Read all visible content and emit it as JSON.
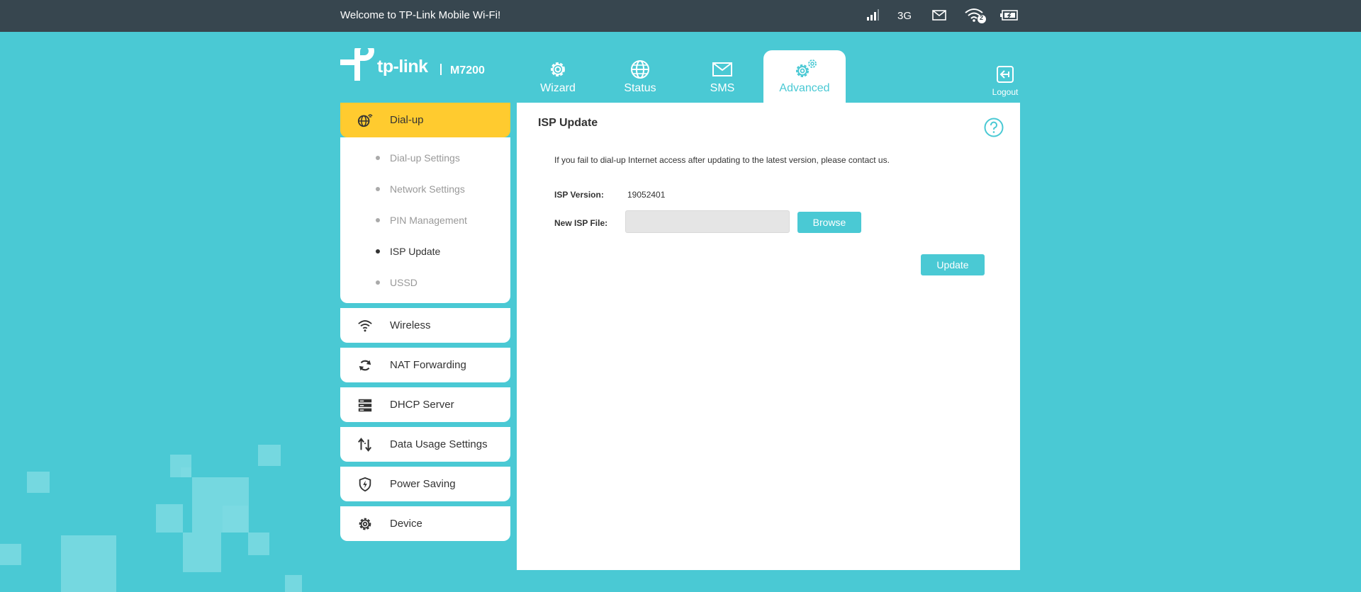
{
  "topbar": {
    "welcome": "Welcome to TP-Link Mobile Wi-Fi!",
    "network_type": "3G",
    "wifi_clients": "2",
    "icons": [
      "signal-icon",
      "mail-icon",
      "wifi-icon",
      "battery-icon"
    ]
  },
  "logo": {
    "brand": "tp-link",
    "model": "M7200"
  },
  "tabs": [
    {
      "label": "Wizard",
      "icon": "gear-icon"
    },
    {
      "label": "Status",
      "icon": "globe-icon"
    },
    {
      "label": "SMS",
      "icon": "envelope-icon"
    },
    {
      "label": "Advanced",
      "icon": "gears-icon",
      "active": true
    }
  ],
  "logout": {
    "label": "Logout"
  },
  "sidebar": {
    "items": [
      {
        "label": "Dial-up",
        "icon": "globe-signal-icon",
        "active": true,
        "sub": [
          {
            "label": "Dial-up Settings"
          },
          {
            "label": "Network Settings"
          },
          {
            "label": "PIN Management"
          },
          {
            "label": "ISP Update",
            "active": true
          },
          {
            "label": "USSD"
          }
        ]
      },
      {
        "label": "Wireless",
        "icon": "wifi-icon"
      },
      {
        "label": "NAT Forwarding",
        "icon": "refresh-icon"
      },
      {
        "label": "DHCP Server",
        "icon": "server-icon"
      },
      {
        "label": "Data Usage Settings",
        "icon": "up-down-arrows-icon"
      },
      {
        "label": "Power Saving",
        "icon": "shield-bolt-icon"
      },
      {
        "label": "Device",
        "icon": "gear-icon"
      }
    ]
  },
  "panel": {
    "title": "ISP Update",
    "note": "If you fail to dial-up Internet access after updating to the latest version, please contact us.",
    "isp_version_label": "ISP Version:",
    "isp_version_value": "19052401",
    "new_file_label": "New ISP File:",
    "new_file_value": "",
    "browse_label": "Browse",
    "update_label": "Update"
  },
  "colors": {
    "accent": "#4ac9d4",
    "topbar": "#37464f",
    "active_menu": "#ffcb2f"
  }
}
